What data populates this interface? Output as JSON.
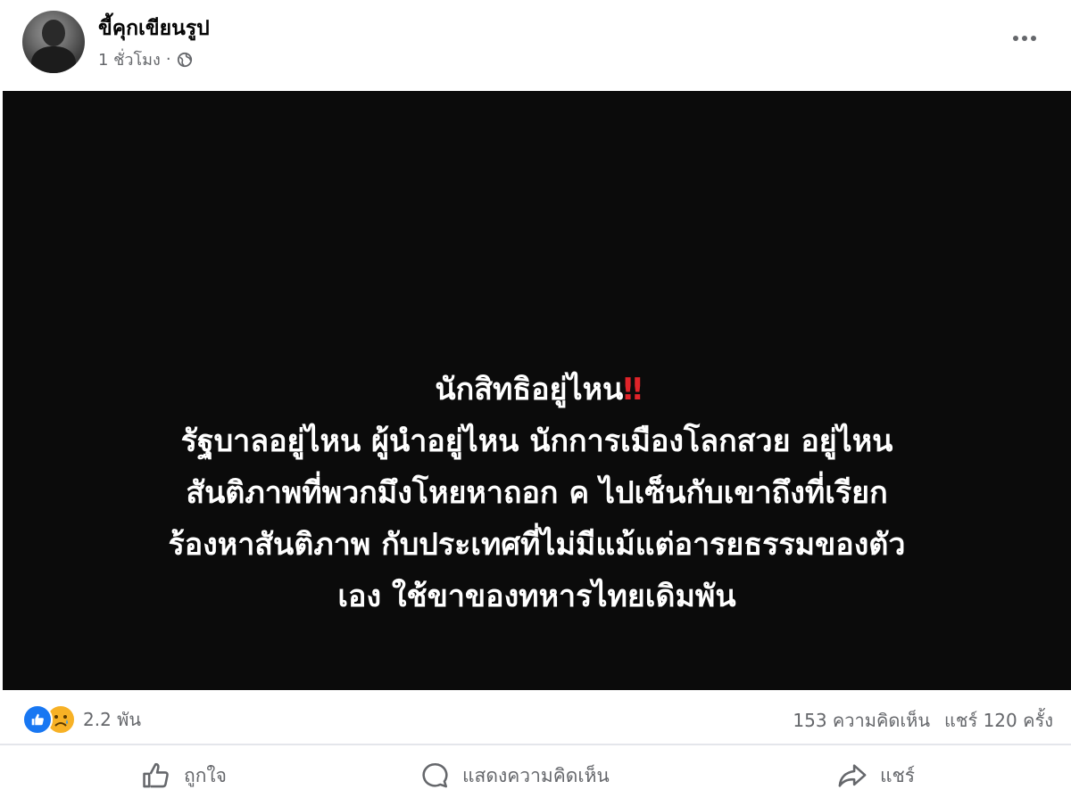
{
  "post": {
    "author": "ขี้คุกเขียนรูป",
    "time": "1 ชั่วโมง",
    "separator": "·",
    "image_text": {
      "line1": "นักสิทธิอยู่ไหน",
      "line1_emoji": "‼",
      "line2": "รัฐบาลอยู่ไหน ผู้นำอยู่ไหน นักการเมืองโลกสวย อยู่ไหน",
      "line3": "สันติภาพที่พวกมึงโหยหาถอก ค ไปเซ็นกับเขาถึงที่เรียก",
      "line4": "ร้องหาสันติภาพ กับประเทศที่ไม่มีแม้แต่อารยธรรมของตัว",
      "line5": "เอง ใช้ขาของทหารไทยเดิมพัน"
    }
  },
  "stats": {
    "reactions": "2.2 พัน",
    "comments": "153 ความคิดเห็น",
    "shares": "แชร์ 120 ครั้ง"
  },
  "actions": {
    "like": "ถูกใจ",
    "comment": "แสดงความคิดเห็น",
    "share": "แชร์"
  },
  "colors": {
    "like_blue": "#1877f2",
    "sad_yellow": "#f7b125",
    "meta_gray": "#65676b",
    "alert_red": "#e0242a"
  },
  "icons": [
    "globe-icon",
    "more-options-icon",
    "like-reaction-icon",
    "sad-reaction-icon",
    "thumbs-up-icon",
    "comment-icon",
    "share-icon"
  ]
}
